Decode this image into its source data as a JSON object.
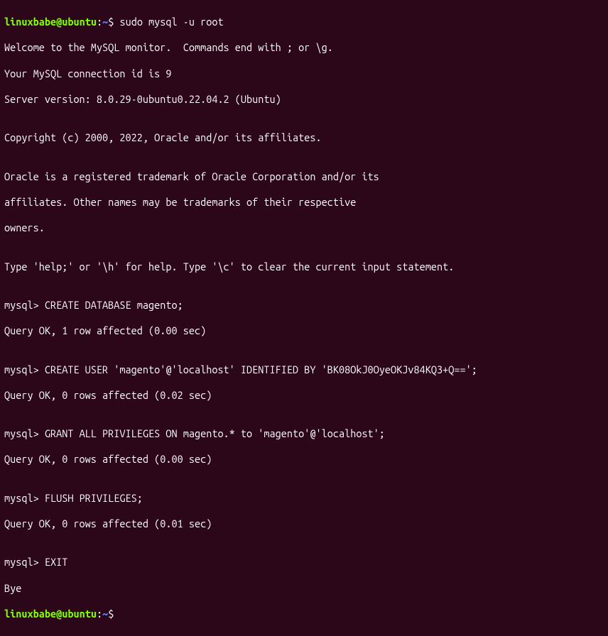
{
  "prompt1": {
    "user": "linuxbabe",
    "at": "@",
    "host": "ubuntu",
    "colon": ":",
    "path": "~",
    "dollar": "$ ",
    "command": "sudo mysql -u root"
  },
  "welcome": {
    "l1": "Welcome to the MySQL monitor.  Commands end with ; or \\g.",
    "l2": "Your MySQL connection id is 9",
    "l3": "Server version: 8.0.29-0ubuntu0.22.04.2 (Ubuntu)"
  },
  "copyright": "Copyright (c) 2000, 2022, Oracle and/or its affiliates.",
  "trademark": {
    "l1": "Oracle is a registered trademark of Oracle Corporation and/or its",
    "l2": "affiliates. Other names may be trademarks of their respective",
    "l3": "owners."
  },
  "help": "Type 'help;' or '\\h' for help. Type '\\c' to clear the current input statement.",
  "stmt1": {
    "prompt": "mysql> ",
    "sql": "CREATE DATABASE magento;",
    "result": "Query OK, 1 row affected (0.00 sec)"
  },
  "stmt2": {
    "prompt": "mysql> ",
    "sql": "CREATE USER 'magento'@'localhost' IDENTIFIED BY 'BK08OkJ0OyeOKJv84KQ3+Q==';",
    "result": "Query OK, 0 rows affected (0.02 sec)"
  },
  "stmt3": {
    "prompt": "mysql> ",
    "sql": "GRANT ALL PRIVILEGES ON magento.* to 'magento'@'localhost';",
    "result": "Query OK, 0 rows affected (0.00 sec)"
  },
  "stmt4": {
    "prompt": "mysql> ",
    "sql": "FLUSH PRIVILEGES;",
    "result": "Query OK, 0 rows affected (0.01 sec)"
  },
  "stmt5": {
    "prompt": "mysql> ",
    "sql": "EXIT",
    "bye": "Bye"
  },
  "prompt2": {
    "user": "linuxbabe",
    "at": "@",
    "host": "ubuntu",
    "colon": ":",
    "path": "~",
    "dollar": "$ "
  },
  "blank": ""
}
